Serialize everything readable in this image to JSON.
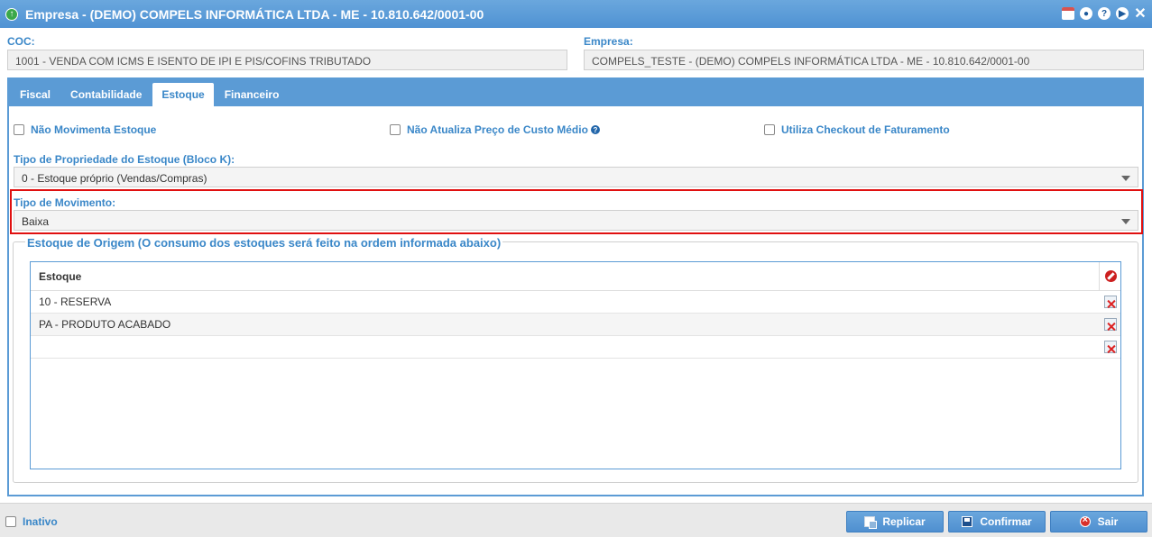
{
  "window": {
    "title": "Empresa - (DEMO) COMPELS INFORMÁTICA LTDA - ME - 10.810.642/0001-00",
    "icons": [
      "back-arrow-icon",
      "calendar-icon",
      "info-icon",
      "help-icon",
      "next-icon",
      "close-icon"
    ]
  },
  "header": {
    "coc_label": "COC:",
    "coc_value": "1001 - VENDA COM ICMS E ISENTO DE IPI E PIS/COFINS TRIBUTADO",
    "empresa_label": "Empresa:",
    "empresa_value": "COMPELS_TESTE - (DEMO) COMPELS INFORMÁTICA LTDA - ME - 10.810.642/0001-00"
  },
  "tabs": [
    {
      "label": "Fiscal",
      "active": false
    },
    {
      "label": "Contabilidade",
      "active": false
    },
    {
      "label": "Estoque",
      "active": true
    },
    {
      "label": "Financeiro",
      "active": false
    }
  ],
  "estoque": {
    "cb_nao_movimenta": "Não Movimenta Estoque",
    "cb_nao_atualiza": "Não Atualiza Preço de Custo Médio",
    "cb_checkout": "Utiliza Checkout de Faturamento",
    "tipo_propriedade_label": "Tipo de Propriedade do Estoque (Bloco K):",
    "tipo_propriedade_value": "0 - Estoque próprio (Vendas/Compras)",
    "tipo_movimento_label": "Tipo de Movimento:",
    "tipo_movimento_value": "Baixa",
    "origem_legend": "Estoque de Origem (O consumo dos estoques será feito na ordem informada abaixo)",
    "grid": {
      "header": "Estoque",
      "rows": [
        "10 - RESERVA",
        "PA - PRODUTO ACABADO",
        ""
      ]
    }
  },
  "footer": {
    "inativo_label": "Inativo",
    "replicar": "Replicar",
    "confirmar": "Confirmar",
    "sair": "Sair"
  },
  "colors": {
    "accent": "#5b9bd5",
    "label": "#3a87c8",
    "highlight": "#e01010"
  }
}
